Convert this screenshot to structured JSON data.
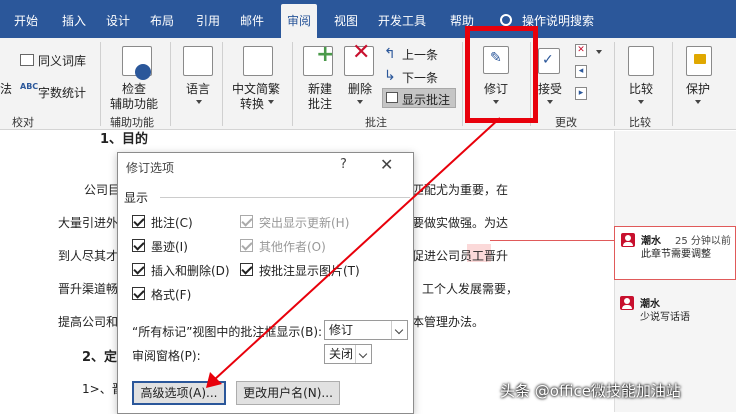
{
  "tabs": [
    "开始",
    "插入",
    "设计",
    "布局",
    "引用",
    "邮件",
    "审阅",
    "视图",
    "开发工具",
    "帮助"
  ],
  "tellme": "操作说明搜索",
  "ribbon": {
    "thesaurus": "同义词库",
    "wordcount": "字数统计",
    "proofing_partial": "法",
    "proofing_group": "校对",
    "accessibility_line1": "检查",
    "accessibility_line2": "辅助功能",
    "accessibility_group": "辅助功能",
    "language": "语言",
    "chinese_line1": "中文简繁",
    "chinese_line2": "转换",
    "new_comment_line1": "新建",
    "new_comment_line2": "批注",
    "delete": "删除",
    "previous": "上一条",
    "next": "下一条",
    "show_comments": "显示批注",
    "comments_group": "批注",
    "track_changes": "修订",
    "accept": "接受",
    "changes_group": "更改",
    "compare": "比较",
    "compare_group": "比较",
    "protect": "保护"
  },
  "document": {
    "heading1": "1、目的",
    "line1_left": "公司目",
    "line1_right": "匹配尤为重要，在",
    "line2_left": "大量引进外",
    "line2_right": "要做实做强。为达",
    "line3_left": "到人尽其才",
    "line3_right": "促进公司员工晋升",
    "line4_left": "晋升渠道畅",
    "line4_right": "工个人发展需要，",
    "line5_left": "提高公司和",
    "line5_right": "本管理办法。",
    "heading2": "2、定",
    "line6": "1>、晋"
  },
  "comments": [
    {
      "author": "潮水",
      "time": "25 分钟以前",
      "text": "此章节需要调整"
    },
    {
      "author": "潮水",
      "time": "",
      "text": "少说写话语"
    }
  ],
  "dialog": {
    "title": "修订选项",
    "help": "?",
    "close": "✕",
    "section": "显示",
    "checkboxes": {
      "comments": "批注(C)",
      "ink": "墨迹(I)",
      "insertions": "插入和删除(D)",
      "formatting": "格式(F)",
      "highlight_updates": "突出显示更新(H)",
      "other_authors": "其他作者(O)",
      "pictures_by_comments": "按批注显示图片(T)"
    },
    "balloons_label": "“所有标记”视图中的批注框显示(B):",
    "balloons_value": "修订",
    "pane_label": "审阅窗格(P):",
    "pane_value": "关闭",
    "advanced_button": "高级选项(A)...",
    "change_user_button": "更改用户名(N)..."
  },
  "watermark": "头条 @office微技能加油站",
  "colors": {
    "accent": "#2b579a",
    "highlight": "#e8000b",
    "comment_marker": "#e05a5a"
  }
}
